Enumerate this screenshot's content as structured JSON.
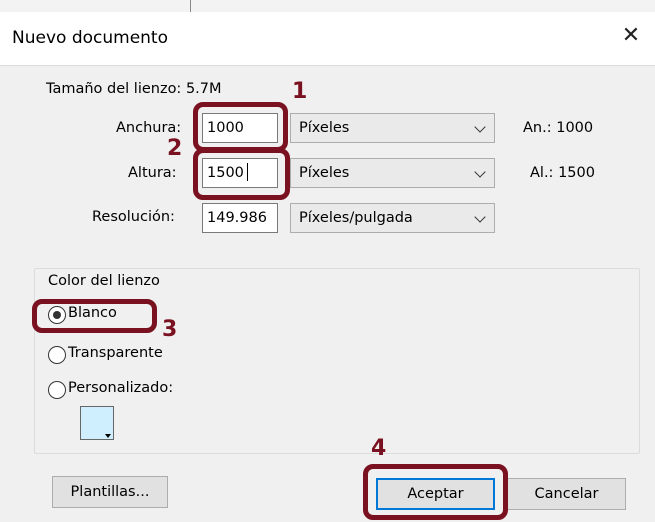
{
  "dialog": {
    "title": "Nuevo documento",
    "close_icon": "close-icon",
    "canvas_size_label": "Tamaño del lienzo:",
    "canvas_size_value": "5.7M"
  },
  "fields": {
    "width_label": "Anchura:",
    "width_value": "1000",
    "width_unit": "Píxeles",
    "width_info_label": "An.:",
    "width_info_value": "1000",
    "height_label": "Altura:",
    "height_value": "1500",
    "height_unit": "Píxeles",
    "height_info_label": "Al.:",
    "height_info_value": "1500",
    "resolution_label": "Resolución:",
    "resolution_value": "149.986",
    "resolution_unit": "Píxeles/pulgada"
  },
  "canvas_color": {
    "group_label": "Color del lienzo",
    "options": [
      "Blanco",
      "Transparente",
      "Personalizado:"
    ],
    "selected": "Blanco",
    "custom_swatch_color": "#cfefff"
  },
  "buttons": {
    "templates": "Plantillas...",
    "accept": "Aceptar",
    "cancel": "Cancelar"
  },
  "annotations": {
    "color": "#7a1120",
    "labels": [
      "1",
      "2",
      "3",
      "4"
    ]
  }
}
